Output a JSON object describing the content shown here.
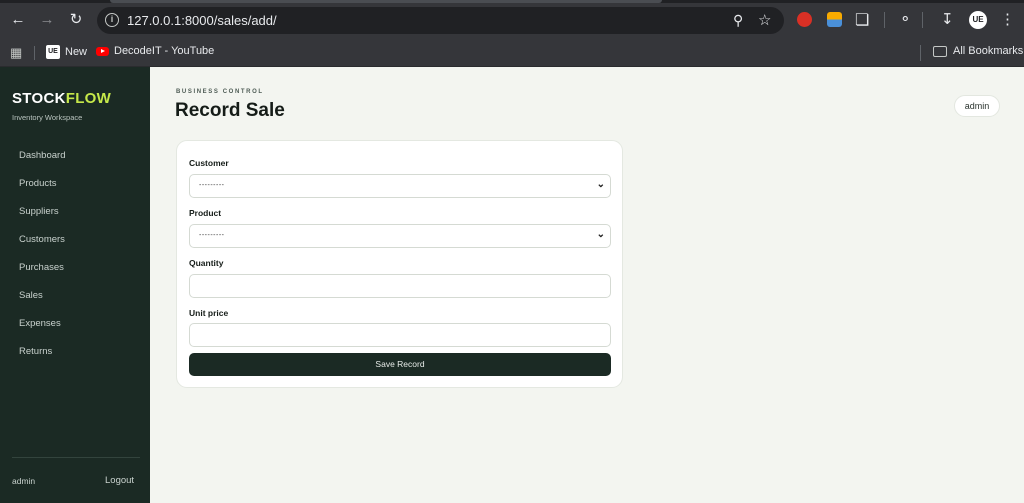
{
  "browser": {
    "url": "127.0.0.1:8000/sales/add/",
    "bookmarks": [
      {
        "label": "New",
        "icon": "uextension-icon"
      },
      {
        "label": "DecodeIT - YouTube",
        "icon": "youtube-icon"
      }
    ],
    "all_bookmarks_label": "All Bookmarks",
    "profile_initials": "UE"
  },
  "sidebar": {
    "brand_part1": "STOCK",
    "brand_part2": "FLOW",
    "brand_color_accent": "#c6e84a",
    "subtitle": "Inventory Workspace",
    "items": [
      {
        "label": "Dashboard"
      },
      {
        "label": "Products"
      },
      {
        "label": "Suppliers"
      },
      {
        "label": "Customers"
      },
      {
        "label": "Purchases"
      },
      {
        "label": "Sales"
      },
      {
        "label": "Expenses"
      },
      {
        "label": "Returns"
      }
    ],
    "user": "admin",
    "logout_label": "Logout"
  },
  "header": {
    "eyebrow": "BUSINESS CONTROL",
    "title": "Record Sale",
    "user_chip": "admin"
  },
  "form": {
    "customer": {
      "label": "Customer",
      "value": "---------"
    },
    "product": {
      "label": "Product",
      "value": "---------"
    },
    "quantity": {
      "label": "Quantity",
      "value": ""
    },
    "unit_price": {
      "label": "Unit price",
      "value": ""
    },
    "submit_label": "Save Record"
  }
}
